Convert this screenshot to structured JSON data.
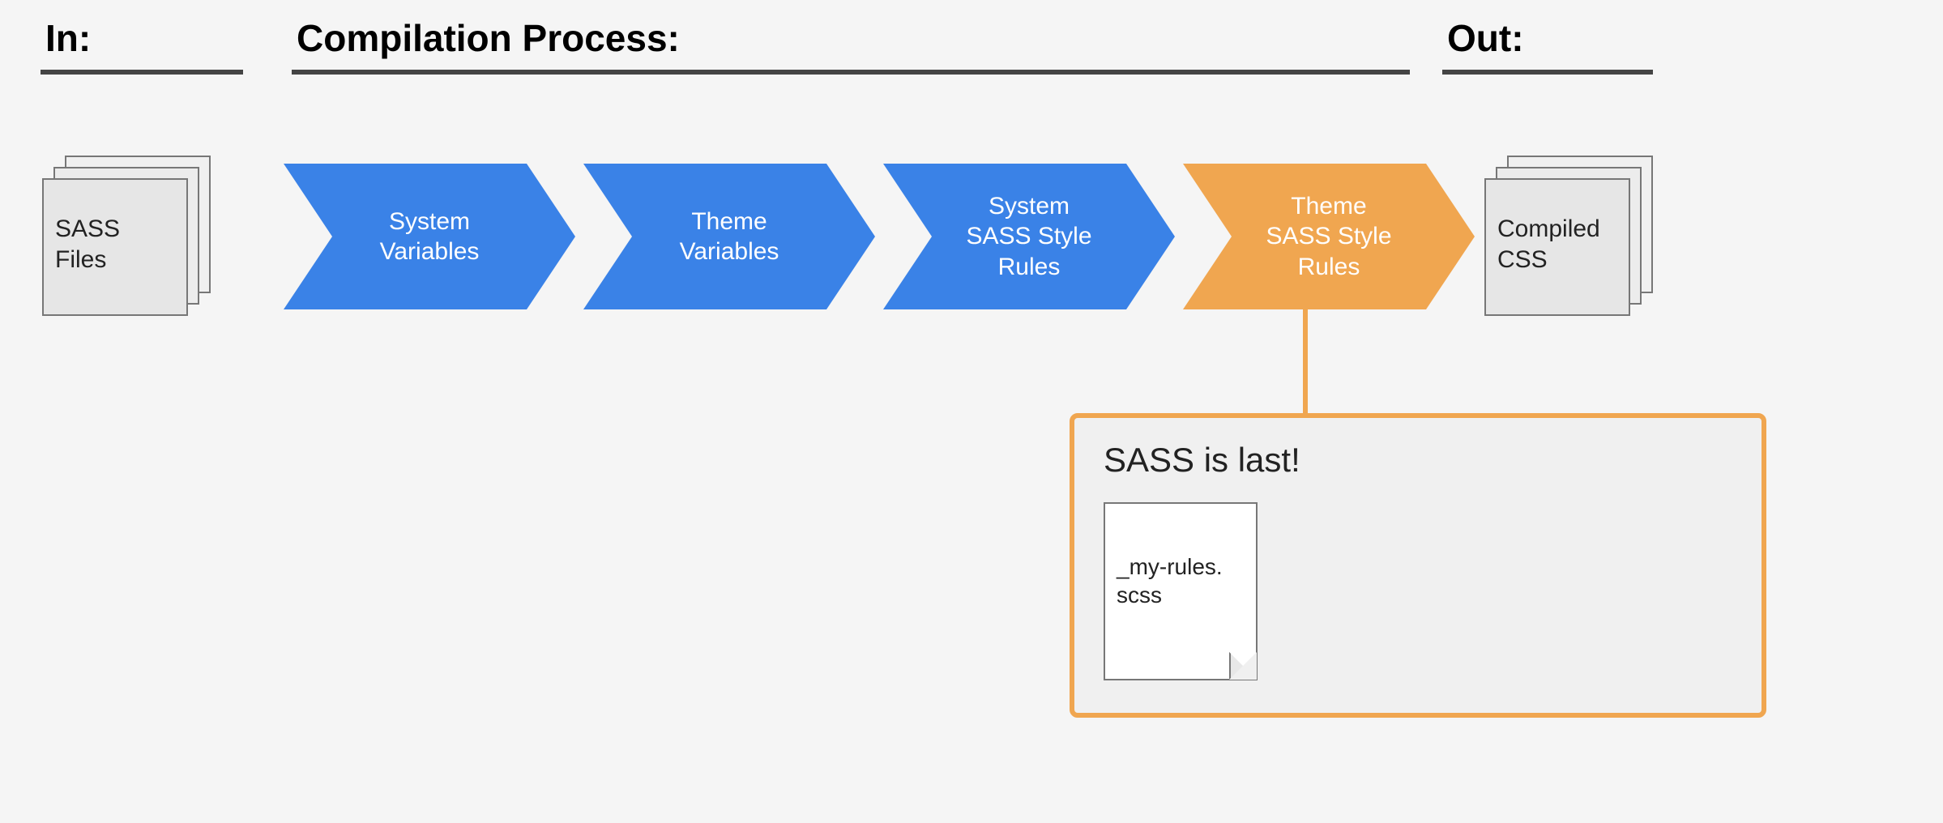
{
  "headers": {
    "in": "In:",
    "process": "Compilation Process:",
    "out": "Out:"
  },
  "input_file_label": "SASS\nFiles",
  "output_file_label": "Compiled\nCSS",
  "steps": {
    "s1": "System\nVariables",
    "s2": "Theme\nVariables",
    "s3": "System\nSASS Style\nRules",
    "s4": "Theme\nSASS Style\nRules"
  },
  "callout": {
    "title": "SASS is last!",
    "doc_label": "_my-rules.\nscss"
  },
  "colors": {
    "blue": "#3a82e7",
    "orange": "#f0a650",
    "rule": "#444444"
  }
}
